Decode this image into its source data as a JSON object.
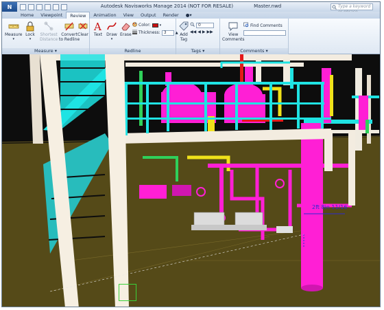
{
  "app": {
    "title": "Autodesk Navisworks Manage 2014 (NOT FOR RESALE)",
    "file_name": "Master.nwd",
    "search_placeholder": "Type a keyword or phrase"
  },
  "tabs": [
    "Home",
    "Viewpoint",
    "Review",
    "Animation",
    "View",
    "Output",
    "Render"
  ],
  "active_tab": "Review",
  "ribbon": {
    "measure_panel": {
      "label": "Measure",
      "measure": "Measure",
      "lock": "Lock",
      "shortest_1": "Shortest",
      "shortest_2": "Distance",
      "convert_1": "Convert",
      "convert_2": "to Redline",
      "clear": "Clear"
    },
    "redline_panel": {
      "label": "Redline",
      "text": "Text",
      "draw": "Draw",
      "erase": "Erase",
      "color_label": "Color:",
      "thickness_label": "Thickness:",
      "thickness_value": "3",
      "color_value": "#c81010"
    },
    "tags_panel": {
      "label": "Tags",
      "add_1": "Add",
      "add_2": "Tag",
      "tag_value": "0"
    },
    "comments_panel": {
      "label": "Comments",
      "view_1": "View",
      "view_2": "Comments",
      "find": "Find Comments"
    }
  },
  "viewport": {
    "measurement_label": "2ft 8in 11/16",
    "colors": {
      "ground": "#554a18",
      "sky": "#0d0d0d",
      "structure": "#f3ece0",
      "railing": "#1fe3e3",
      "vessel": "#ff1fd5",
      "pipe_yellow": "#f0e11a",
      "pipe_green": "#2fd05a",
      "pipe_red": "#e51919"
    }
  }
}
